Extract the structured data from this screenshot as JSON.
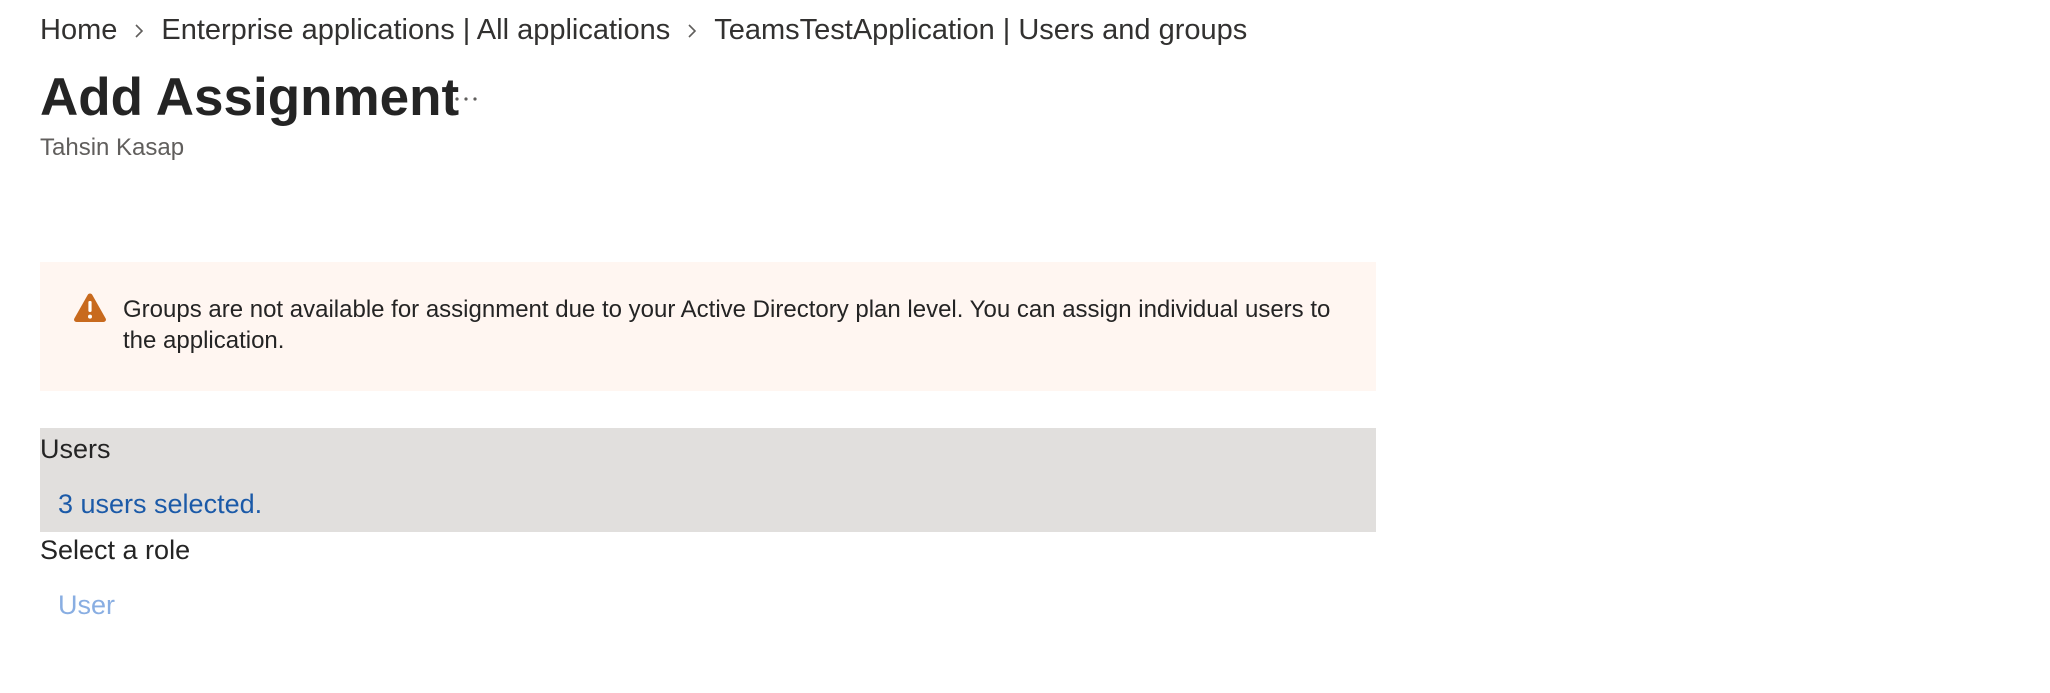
{
  "breadcrumb": {
    "items": [
      {
        "label": "Home"
      },
      {
        "label": "Enterprise applications | All applications"
      },
      {
        "label": "TeamsTestApplication | Users and groups"
      }
    ]
  },
  "header": {
    "title": "Add Assignment",
    "more_label": "...",
    "subtitle": "Tahsin Kasap"
  },
  "warning": {
    "icon": "warning-triangle-icon",
    "color": "#c86a1e",
    "text": "Groups are not available for assignment due to your Active Directory plan level. You can assign individual users to the application."
  },
  "users": {
    "label": "Users",
    "selected_text": "3 users selected."
  },
  "role": {
    "label": "Select a role",
    "value": "User"
  },
  "colors": {
    "warning_bg": "#fff6f1",
    "selected_section_bg": "#e1dfdd",
    "link": "#1b5aa8",
    "link_disabled": "#89aee2"
  }
}
